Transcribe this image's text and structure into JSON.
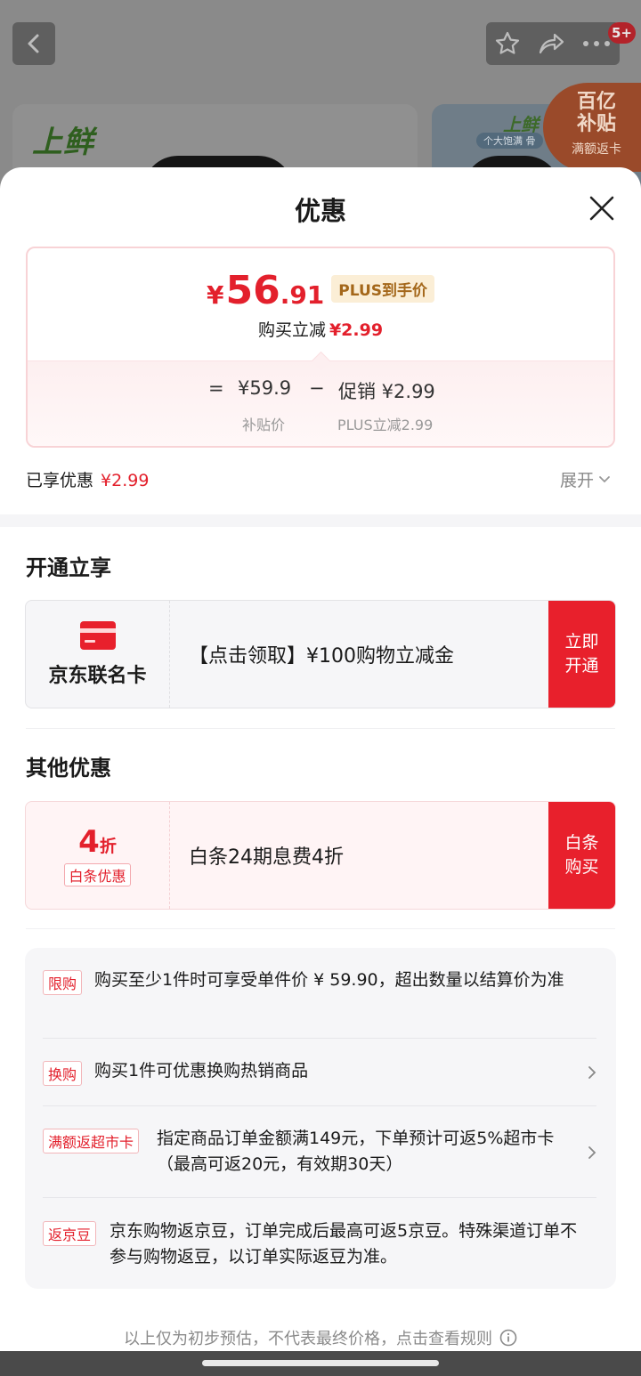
{
  "background": {
    "badge_count": "5+",
    "brand": "上鲜",
    "brand_right": "上鲜",
    "pill": "个大饱满 骨",
    "subsidy": {
      "line1": "百亿",
      "line2": "补贴",
      "line3": "满额返卡"
    }
  },
  "sheet": {
    "title": "优惠",
    "price_card": {
      "currency": "¥",
      "price_int": "56",
      "price_dec": ".91",
      "plus_tag": "PLUS到手价",
      "reduce_label": "购买立减",
      "reduce_value": "¥2.99",
      "eq": "=",
      "base_price": "¥59.9",
      "minus": "−",
      "promo_label": "促销 ¥2.99",
      "base_label": "补贴价",
      "promo_sub": "PLUS立减2.99"
    },
    "enjoyed_label": "已享优惠",
    "enjoyed_value": "¥2.99",
    "expand_label": "展开"
  },
  "open_section": {
    "title": "开通立享",
    "card_name": "京东联名卡",
    "offer_text": "【点击领取】¥100购物立减金",
    "button_line1": "立即",
    "button_line2": "开通"
  },
  "other_section": {
    "title": "其他优惠",
    "discount_num": "4",
    "discount_unit": "折",
    "discount_tag": "白条优惠",
    "offer_text": "白条24期息费4折",
    "button_line1": "白条",
    "button_line2": "购买"
  },
  "info": [
    {
      "tag": "限购",
      "text": "购买至少1件时可享受单件价 ¥ 59.90，超出数量以结算价为准"
    },
    {
      "tag": "换购",
      "text": "购买1件可优惠换购热销商品"
    },
    {
      "tag": "满额返超市卡",
      "text": "指定商品订单金额满149元，下单预计可返5%超市卡（最高可返20元，有效期30天）"
    },
    {
      "tag": "返京豆",
      "text": "京东购物返京豆，订单完成后最高可返5京豆。特殊渠道订单不参与购物返豆，以订单实际返豆为准。"
    }
  ],
  "footer_note": "以上仅为初步预估，不代表最终价格，点击查看规则",
  "colors": {
    "accent_red": "#e3202c",
    "button_red": "#e8202c",
    "plus_gold": "#a4671a"
  }
}
